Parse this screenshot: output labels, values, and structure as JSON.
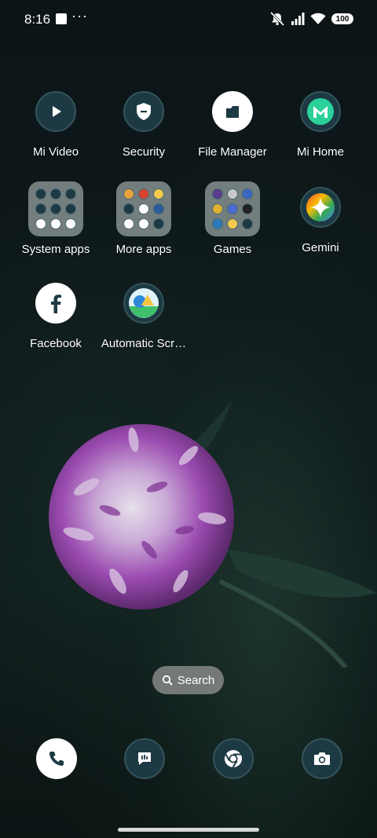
{
  "status_bar": {
    "time": "8:16",
    "more": "···",
    "battery": "100"
  },
  "apps": [
    {
      "label": "Mi Video",
      "icon": "play-icon"
    },
    {
      "label": "Security",
      "icon": "shield-icon"
    },
    {
      "label": "File Manager",
      "icon": "folder-file-icon"
    },
    {
      "label": "Mi Home",
      "icon": "mi-home-icon"
    },
    {
      "label": "System apps",
      "icon": "folder-icon"
    },
    {
      "label": "More apps",
      "icon": "folder-icon"
    },
    {
      "label": "Games",
      "icon": "folder-icon"
    },
    {
      "label": "Gemini",
      "icon": "gemini-icon"
    },
    {
      "label": "Facebook",
      "icon": "facebook-icon"
    },
    {
      "label": "Automatic Scr…",
      "icon": "image-shapes-icon"
    }
  ],
  "search": {
    "label": "Search"
  },
  "dock": [
    {
      "name": "Phone",
      "icon": "phone-icon"
    },
    {
      "name": "Messages",
      "icon": "message-icon"
    },
    {
      "name": "Chrome",
      "icon": "chrome-icon"
    },
    {
      "name": "Camera",
      "icon": "camera-icon"
    }
  ],
  "colors": {
    "icon_bg": "#1d3a44",
    "mi_home": "#2bd19a",
    "folder_bg": "#96a0a0"
  }
}
